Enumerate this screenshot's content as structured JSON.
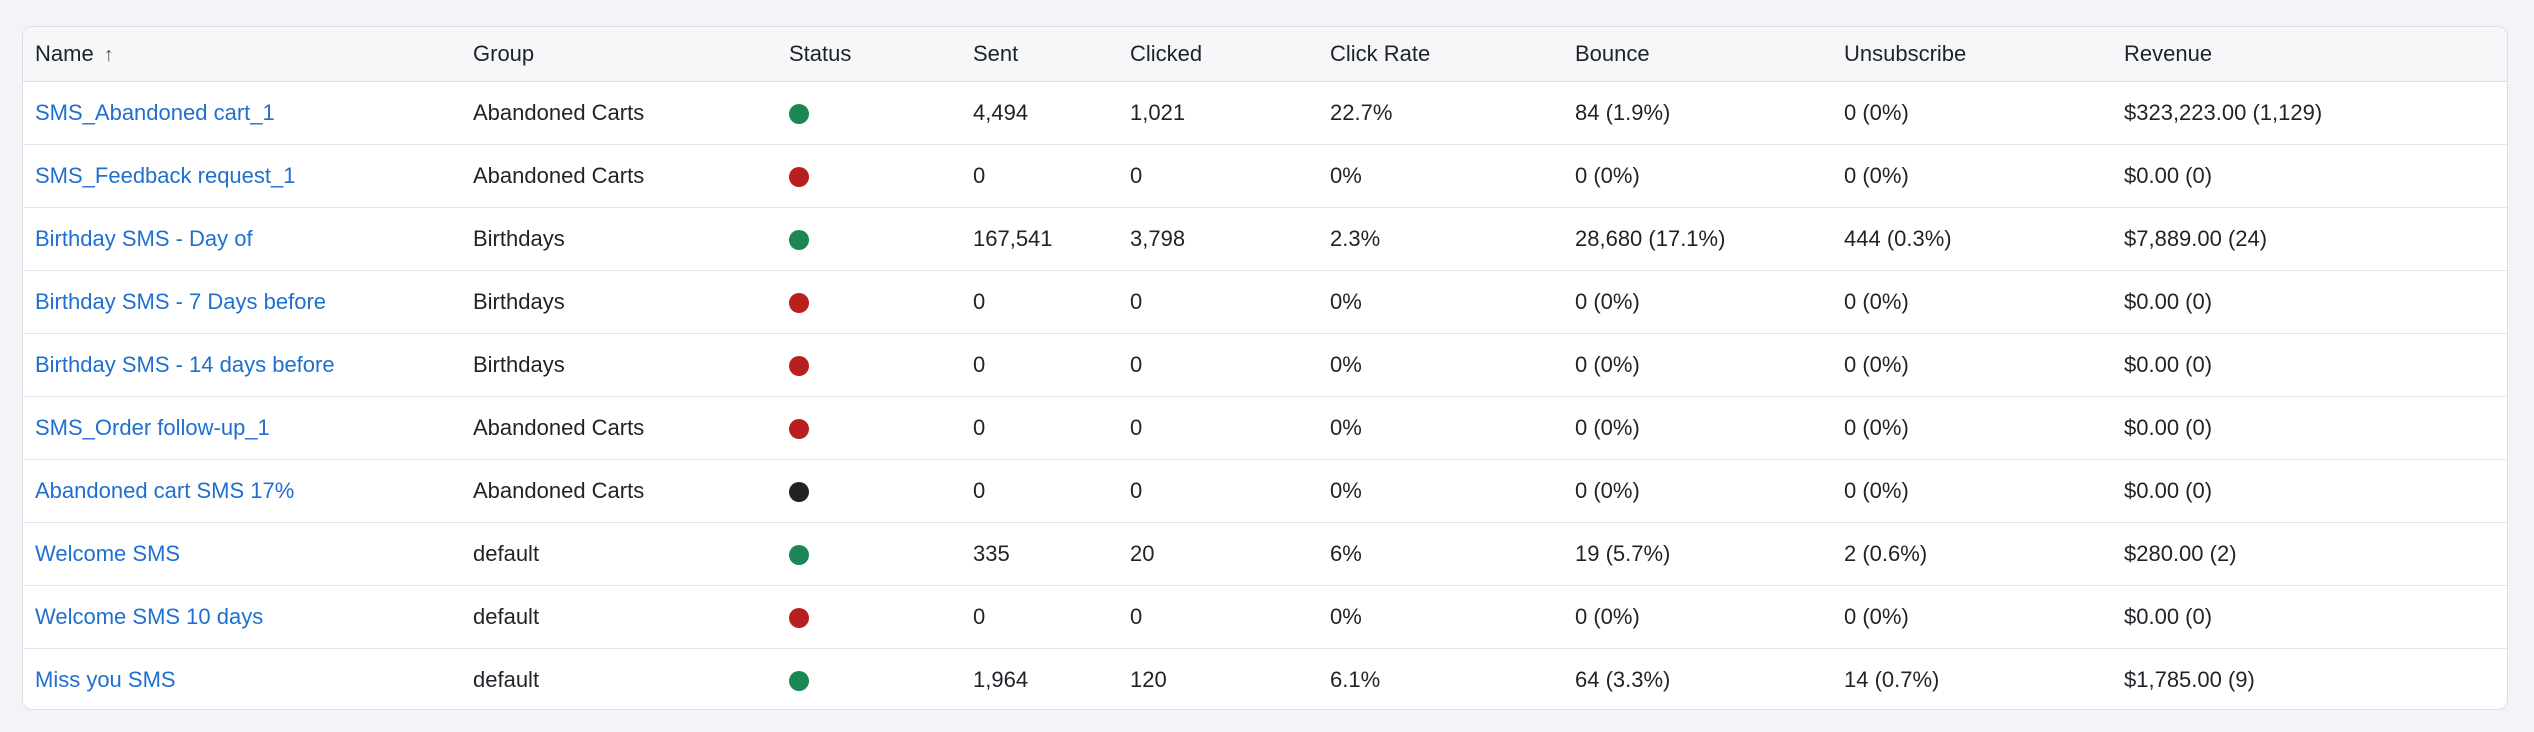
{
  "colors": {
    "live": "#1a8754",
    "paused": "#b91f1f",
    "draft": "#222222",
    "link": "#1f6fd1"
  },
  "table": {
    "headers": {
      "name": "Name",
      "sort_icon": "↑",
      "group": "Group",
      "status": "Status",
      "sent": "Sent",
      "clicked": "Clicked",
      "click_rate": "Click Rate",
      "bounce": "Bounce",
      "unsubscribe": "Unsubscribe",
      "revenue": "Revenue"
    },
    "rows": [
      {
        "name": "SMS_Abandoned cart_1",
        "group": "Abandoned Carts",
        "status": "green",
        "sent": "4,494",
        "clicked": "1,021",
        "click_rate": "22.7%",
        "bounce": "84 (1.9%)",
        "unsubscribe": "0 (0%)",
        "revenue": "$323,223.00 (1,129)"
      },
      {
        "name": "SMS_Feedback request_1",
        "group": "Abandoned Carts",
        "status": "red",
        "sent": "0",
        "clicked": "0",
        "click_rate": "0%",
        "bounce": "0 (0%)",
        "unsubscribe": "0 (0%)",
        "revenue": "$0.00 (0)"
      },
      {
        "name": "Birthday SMS - Day of",
        "group": "Birthdays",
        "status": "green",
        "sent": "167,541",
        "clicked": "3,798",
        "click_rate": "2.3%",
        "bounce": "28,680 (17.1%)",
        "unsubscribe": "444 (0.3%)",
        "revenue": "$7,889.00 (24)"
      },
      {
        "name": "Birthday SMS - 7 Days before",
        "group": "Birthdays",
        "status": "red",
        "sent": "0",
        "clicked": "0",
        "click_rate": "0%",
        "bounce": "0 (0%)",
        "unsubscribe": "0 (0%)",
        "revenue": "$0.00 (0)"
      },
      {
        "name": "Birthday SMS - 14 days before",
        "group": "Birthdays",
        "status": "red",
        "sent": "0",
        "clicked": "0",
        "click_rate": "0%",
        "bounce": "0 (0%)",
        "unsubscribe": "0 (0%)",
        "revenue": "$0.00 (0)"
      },
      {
        "name": "SMS_Order follow-up_1",
        "group": "Abandoned Carts",
        "status": "red",
        "sent": "0",
        "clicked": "0",
        "click_rate": "0%",
        "bounce": "0 (0%)",
        "unsubscribe": "0 (0%)",
        "revenue": "$0.00 (0)"
      },
      {
        "name": "Abandoned cart SMS 17%",
        "group": "Abandoned Carts",
        "status": "black",
        "sent": "0",
        "clicked": "0",
        "click_rate": "0%",
        "bounce": "0 (0%)",
        "unsubscribe": "0 (0%)",
        "revenue": "$0.00 (0)"
      },
      {
        "name": "Welcome SMS",
        "group": "default",
        "status": "green",
        "sent": "335",
        "clicked": "20",
        "click_rate": "6%",
        "bounce": "19 (5.7%)",
        "unsubscribe": "2 (0.6%)",
        "revenue": "$280.00 (2)"
      },
      {
        "name": "Welcome SMS 10 days",
        "group": "default",
        "status": "red",
        "sent": "0",
        "clicked": "0",
        "click_rate": "0%",
        "bounce": "0 (0%)",
        "unsubscribe": "0 (0%)",
        "revenue": "$0.00 (0)"
      },
      {
        "name": "Miss you SMS",
        "group": "default",
        "status": "green",
        "sent": "1,964",
        "clicked": "120",
        "click_rate": "6.1%",
        "bounce": "64 (3.3%)",
        "unsubscribe": "14 (0.7%)",
        "revenue": "$1,785.00 (9)"
      }
    ]
  }
}
